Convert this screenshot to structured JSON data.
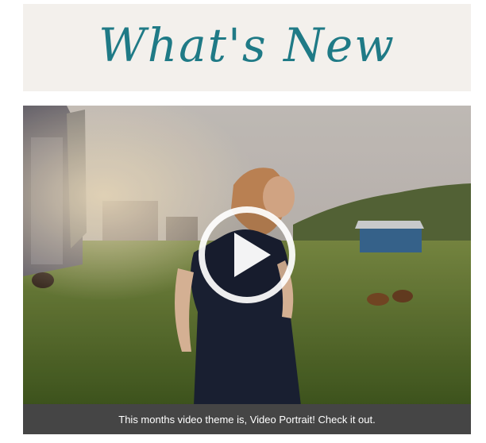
{
  "banner": {
    "heading": "What's New",
    "heading_color": "#1f7a86",
    "background": "#f3f0ec"
  },
  "video": {
    "caption": "This months video theme is, Video Portrait! Check it out.",
    "caption_bg": "#454545",
    "play_icon": "play-icon"
  }
}
